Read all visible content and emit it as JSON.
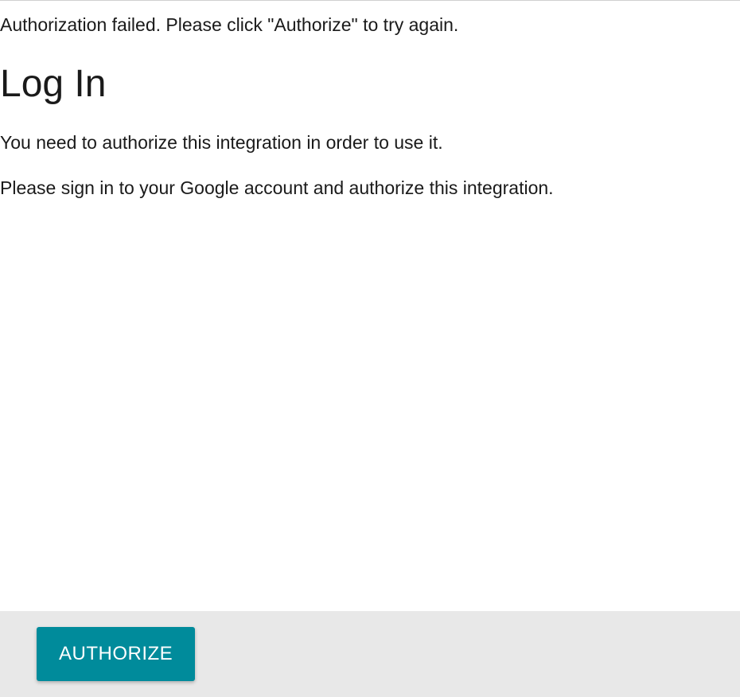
{
  "error_message": "Authorization failed. Please click \"Authorize\" to try again.",
  "page_title": "Log In",
  "description": "You need to authorize this integration in order to use it.",
  "instruction": "Please sign in to your Google account and authorize this integration.",
  "footer": {
    "authorize_label": "AUTHORIZE"
  },
  "colors": {
    "button_bg": "#008b9b",
    "footer_bg": "#e8e8e8"
  }
}
